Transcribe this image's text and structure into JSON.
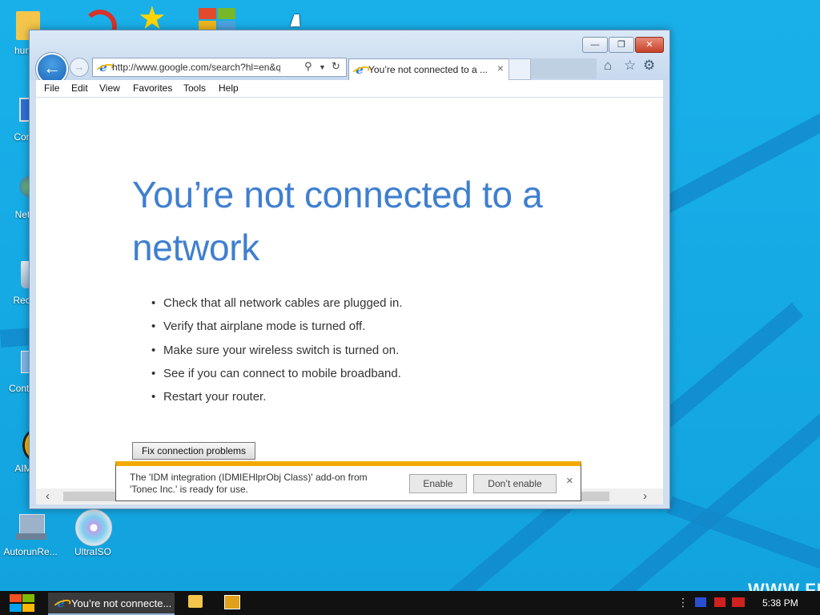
{
  "desktop": {
    "icons": [
      {
        "label": "hun"
      },
      {
        "label": "Com"
      },
      {
        "label": "Net"
      },
      {
        "label": "Recy"
      },
      {
        "label": "Contro"
      },
      {
        "label": "AIM"
      },
      {
        "label": "AutorunRe..."
      },
      {
        "label": "UltraISO"
      }
    ],
    "watermark": "WWW.FR"
  },
  "browser": {
    "address_url": "http://www.google.com/search?hl=en&q=c",
    "tab_title": "You’re not connected to a ...",
    "tab_close": "×",
    "window_buttons": {
      "minimize": "—",
      "restore": "❐",
      "close": "✕"
    },
    "menu": [
      "File",
      "Edit",
      "View",
      "Favorites",
      "Tools",
      "Help"
    ],
    "page": {
      "headline": "You’re not connected to a network",
      "tips": [
        "Check that all network cables are plugged in.",
        "Verify that airplane mode is turned off.",
        "Make sure your wireless switch is turned on.",
        "See if you can connect to mobile broadband.",
        "Restart your router."
      ],
      "fix_button": "Fix connection problems"
    },
    "notification": {
      "message": "The 'IDM integration (IDMIEHlprObj Class)' add-on from 'Tonec Inc.' is ready for use.",
      "enable": "Enable",
      "dont_enable": "Don’t enable",
      "close": "×"
    }
  },
  "taskbar": {
    "window_label": "You’re not connecte...",
    "clock": "5:38 PM"
  },
  "colors": {
    "desktop_bg": "#17a9e3",
    "headline_blue": "#3f7fd0",
    "notification_accent": "#f2a900",
    "taskbar": "#111111"
  }
}
